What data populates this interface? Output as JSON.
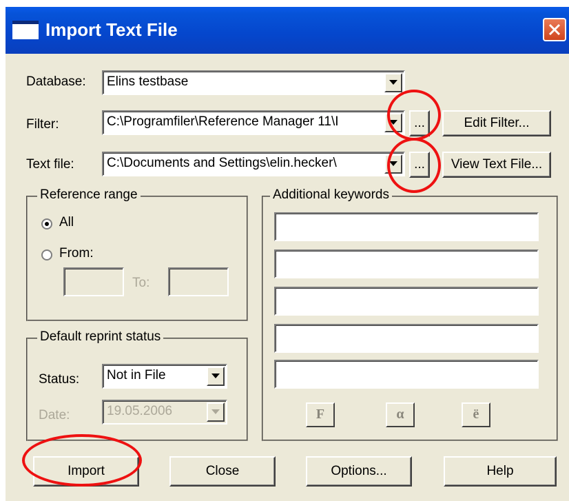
{
  "window": {
    "title": "Import Text File"
  },
  "database": {
    "label": "Database:",
    "value": "Elins testbase"
  },
  "filter": {
    "label": "Filter:",
    "value": "C:\\Programfiler\\Reference Manager 11\\I",
    "browse_label": "...",
    "edit_label": "Edit Filter..."
  },
  "textfile": {
    "label": "Text file:",
    "value": "C:\\Documents and Settings\\elin.hecker\\",
    "browse_label": "...",
    "view_label": "View Text File..."
  },
  "reference_range": {
    "title": "Reference range",
    "all_label": "All",
    "from_label": "From:",
    "to_label": "To:",
    "from_value": "",
    "to_value": "",
    "selected": "All"
  },
  "reprint": {
    "title": "Default reprint status",
    "status_label": "Status:",
    "status_value": "Not in File",
    "date_label": "Date:",
    "date_value": "19.05.2006"
  },
  "keywords": {
    "title": "Additional keywords",
    "values": [
      "",
      "",
      "",
      "",
      ""
    ],
    "symbol_buttons": [
      "F",
      "α",
      "ë"
    ]
  },
  "footer": {
    "import_label": "Import",
    "close_label": "Close",
    "options_label": "Options...",
    "help_label": "Help"
  },
  "colors": {
    "annotation_ring": "#ee1111",
    "titlebar": "#0546cc",
    "dialog_bg": "#ece9d8"
  }
}
